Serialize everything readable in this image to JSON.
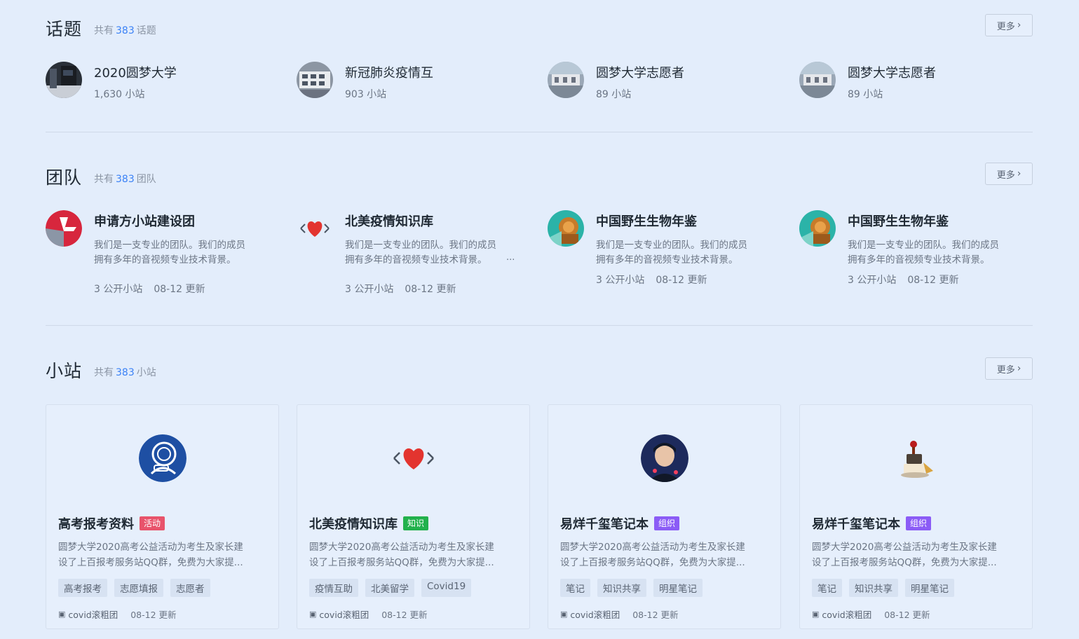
{
  "topics": {
    "title": "话题",
    "count_prefix": "共有",
    "count": "383",
    "count_suffix": "话题",
    "more_label": "更多",
    "items": [
      {
        "name": "2020圆梦大学",
        "stat": "1,630 小站",
        "icon": "photo-avatar"
      },
      {
        "name": "新冠肺炎疫情互",
        "stat": "903 小站",
        "icon": "photo-avatar"
      },
      {
        "name": "圆梦大学志愿者",
        "stat": "89 小站",
        "icon": "photo-avatar"
      },
      {
        "name": "圆梦大学志愿者",
        "stat": "89 小站",
        "icon": "photo-avatar"
      }
    ]
  },
  "teams": {
    "title": "团队",
    "count_prefix": "共有",
    "count": "383",
    "count_suffix": "团队",
    "more_label": "更多",
    "items": [
      {
        "name": "申请方小站建设团",
        "desc1": "我们是一支专业的团队。我们的成员",
        "desc2": "拥有多年的音视频专业技术背景。",
        "public": "3 公开小站",
        "updated": "08-12 更新"
      },
      {
        "name": "北美疫情知识库",
        "desc1": "我们是一支专业的团队。我们的成员",
        "desc2": "拥有多年的音视频专业技术背景。",
        "ellipsis": "...",
        "public": "3 公开小站",
        "updated": "08-12 更新"
      },
      {
        "name": "中国野生生物年鉴",
        "desc1": "我们是一支专业的团队。我们的成员",
        "desc2": "拥有多年的音视频专业技术背景。",
        "public": "3 公开小站",
        "updated": "08-12 更新"
      },
      {
        "name": "中国野生生物年鉴",
        "desc1": "我们是一支专业的团队。我们的成员",
        "desc2": "拥有多年的音视频专业技术背景。",
        "public": "3 公开小站",
        "updated": "08-12 更新"
      }
    ]
  },
  "stations": {
    "title": "小站",
    "count_prefix": "共有",
    "count": "383",
    "count_suffix": "小站",
    "more_label": "更多",
    "items": [
      {
        "name": "高考报考资料",
        "badge": "活动",
        "badge_color": "#e8536b",
        "desc1": "圆梦大学2020高考公益活动为考生及家长建",
        "desc2": "设了上百报考服务站QQ群，免费为大家提...",
        "tags": [
          "高考报考",
          "志愿填报",
          "志愿者"
        ],
        "owner": "covid滚粗团",
        "updated": "08-12 更新"
      },
      {
        "name": "北美疫情知识库",
        "badge": "知识",
        "badge_color": "#22b14c",
        "desc1": "圆梦大学2020高考公益活动为考生及家长建",
        "desc2": "设了上百报考服务站QQ群，免费为大家提...",
        "tags": [
          "疫情互助",
          "北美留学",
          "Covid19"
        ],
        "owner": "covid滚粗团",
        "updated": "08-12 更新"
      },
      {
        "name": "易烊千玺笔记本",
        "badge": "组织",
        "badge_color": "#8b5cf6",
        "desc1": "圆梦大学2020高考公益活动为考生及家长建",
        "desc2": "设了上百报考服务站QQ群，免费为大家提...",
        "tags": [
          "笔记",
          "知识共享",
          "明星笔记"
        ],
        "owner": "covid滚粗团",
        "updated": "08-12 更新"
      },
      {
        "name": "易烊千玺笔记本",
        "badge": "组织",
        "badge_color": "#8b5cf6",
        "desc1": "圆梦大学2020高考公益活动为考生及家长建",
        "desc2": "设了上百报考服务站QQ群，免费为大家提...",
        "tags": [
          "笔记",
          "知识共享",
          "明星笔记"
        ],
        "owner": "covid滚粗团",
        "updated": "08-12 更新"
      }
    ]
  }
}
